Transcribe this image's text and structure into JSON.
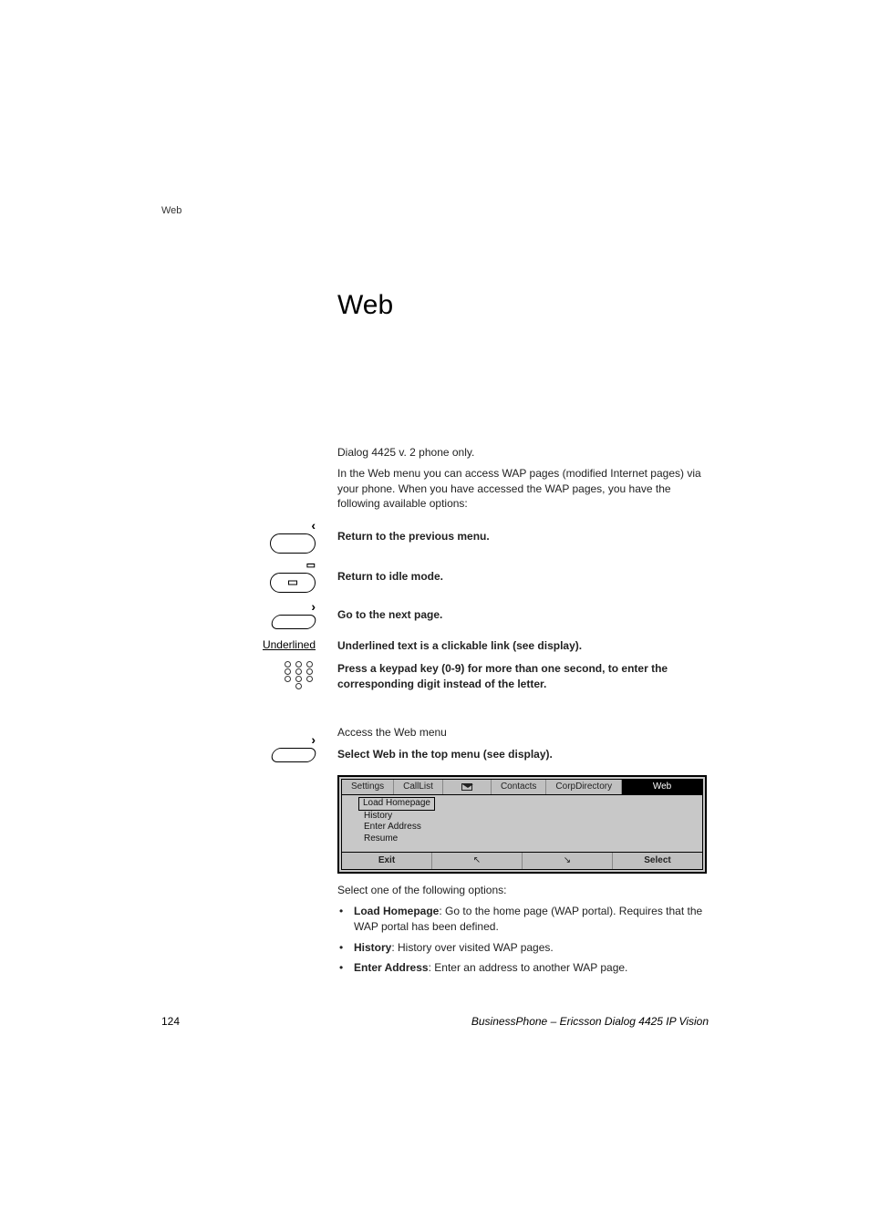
{
  "header": {
    "section": "Web"
  },
  "title": "Web",
  "intro": {
    "line1": "Dialog 4425 v. 2 phone only.",
    "line2": "In the Web menu you can access WAP pages (modified Internet pages) via your phone. When you have accessed the WAP pages, you have the following available options:"
  },
  "keys": {
    "return_prev": "Return to the previous menu.",
    "return_idle": "Return to idle mode.",
    "next_page": "Go to the next page.",
    "underlined_label": "Underlined",
    "underlined_text": "Underlined text is a clickable link (see display).",
    "keypad_text": "Press a keypad key (0-9) for more than one second, to enter the corresponding digit instead of the letter."
  },
  "access": {
    "heading": "Access the Web menu",
    "step": "Select Web in the top menu (see display)."
  },
  "display": {
    "tabs": [
      "Settings",
      "CallList",
      "",
      "Contacts",
      "CorpDirectory",
      "Web"
    ],
    "menu": [
      "Load Homepage",
      "History",
      "Enter Address",
      "Resume"
    ],
    "softkeys": [
      "Exit",
      "↖",
      "↘",
      "Select"
    ]
  },
  "options_intro": "Select one of the following options:",
  "options": [
    {
      "bold": "Load Homepage",
      "text": ": Go to the home page (WAP portal). Requires that the WAP portal has been defined."
    },
    {
      "bold": "History",
      "text": ": History over visited WAP pages."
    },
    {
      "bold": "Enter Address",
      "text": ": Enter an address to another WAP page."
    }
  ],
  "footer": {
    "page": "124",
    "doc": "BusinessPhone – Ericsson Dialog 4425 IP Vision"
  }
}
